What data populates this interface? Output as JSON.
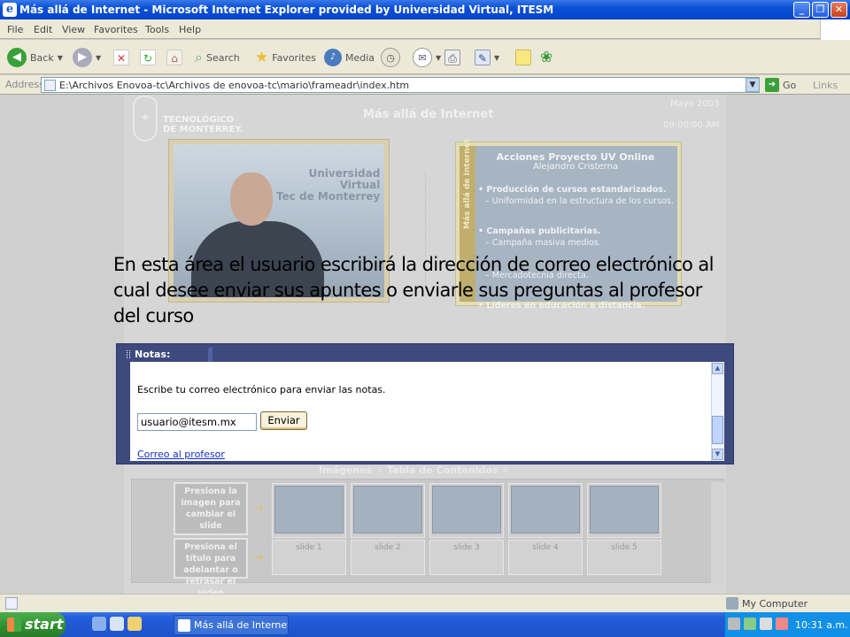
{
  "window": {
    "title": "Más allá de Internet - Microsoft Internet Explorer provided by Universidad Virtual, ITESM",
    "icon": "ie-icon"
  },
  "menu": [
    "File",
    "Edit",
    "View",
    "Favorites",
    "Tools",
    "Help"
  ],
  "toolbar": {
    "back": "Back",
    "search": "Search",
    "favorites": "Favorites",
    "media": "Media"
  },
  "address": {
    "label": "Address",
    "url": "E:\\Archivos Enovoa-tc\\Archivos de enovoa-tc\\mario\\frameadr\\index.htm",
    "go": "Go",
    "links": "Links"
  },
  "page": {
    "logo_text": "TECNOLÓGICO\nDE MONTERREY.",
    "title": "Más allá de Internet",
    "date": "Mayo 2003",
    "time": "09:00:00 AM",
    "video_brand": "Universidad\nVirtual\nTec de Monterrey",
    "slide": {
      "side_label": "Más allá de Internet",
      "title": "Acciones Proyecto UV Online",
      "author": "Alejandro Cristerna",
      "lines": [
        "• Producción de cursos estandarizados.",
        "– Uniformidad en la estructura de los cursos.",
        "• Campañas publicitarias.",
        "– Campaña masiva medios.",
        "– Mercadotecnia directa.",
        "• Líderes en educación a distancia."
      ]
    },
    "tabs": "Imágenes  ✧  Tabla de Contenidos ✧",
    "hint_image": "Presiona la imagen para cambiar el slide",
    "hint_title": "Presiona el título para adelantar o retrasar el video",
    "slides": [
      "slide 1",
      "slide 2",
      "slide 3",
      "slide 4",
      "slide 5"
    ]
  },
  "annotation": "En esta área el usuario escribirá la dirección de correo electrónico al cual desee enviar sus apuntes o enviarle sus preguntas al profesor del curso",
  "notes": {
    "tab": "Notas:",
    "prompt": "Escribe tu correo electrónico para enviar las notas.",
    "email_value": "usuario@itesm.mx",
    "send": "Enviar",
    "link": "Correo al profesor"
  },
  "status": {
    "zone": "My Computer"
  },
  "taskbar": {
    "start": "start",
    "task": "Más allá de Internet -...",
    "clock": "10:31 a.m."
  }
}
